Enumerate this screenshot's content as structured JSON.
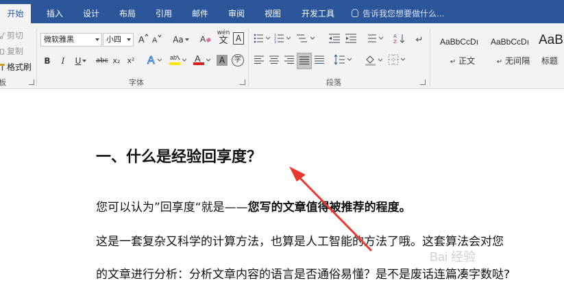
{
  "tabs": [
    {
      "label": "开始",
      "active": true
    },
    {
      "label": "插入"
    },
    {
      "label": "设计"
    },
    {
      "label": "布局"
    },
    {
      "label": "引用"
    },
    {
      "label": "邮件"
    },
    {
      "label": "审阅"
    },
    {
      "label": "视图"
    },
    {
      "label": "开发工具"
    }
  ],
  "tell_me": "告诉我您想要做什么...",
  "clipboard": {
    "cut": "剪切",
    "copy": "复制",
    "format_painter": "格式刷",
    "group_label": "板"
  },
  "font": {
    "name": "微软雅黑",
    "size": "小四",
    "aa": "Aa",
    "pinyin_label": "wén",
    "char_border_label": "A",
    "bold": "B",
    "italic": "I",
    "underline": "U",
    "strike": "abc",
    "sub": "x₂",
    "sup": "x²",
    "highlight_color": "#ffe600",
    "font_color": "#d32020",
    "enclose_label": "字",
    "group_label": "字体"
  },
  "paragraph": {
    "group_label": "段落"
  },
  "styles": [
    {
      "sample": "AaBbCcDı",
      "name": "正文",
      "prefix": "↵"
    },
    {
      "sample": "AaBbCcDı",
      "name": "无间隔",
      "prefix": "↵"
    },
    {
      "sample": "AaB",
      "name": "标题"
    }
  ],
  "document": {
    "heading": "一、什么是经验回享度？",
    "para1_normal": "您可以认为”回享度“就是——",
    "para1_bold": "您写的文章值得被推荐的程度。",
    "para2": "这是一套复杂又科学的计算方法，也算是人工智能的方法了哦。这套算法会对您",
    "para3": "的文章进行分析：分析文章内容的语言是否通俗易懂？是不是废话连篇凑字数哒?",
    "annotation_color": "#e8382f",
    "watermark": "Bai 经验"
  }
}
